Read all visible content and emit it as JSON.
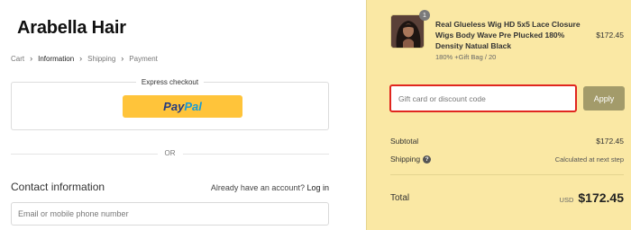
{
  "brand": {
    "name": "Arabella Hair"
  },
  "breadcrumb": {
    "items": [
      "Cart",
      "Information",
      "Shipping",
      "Payment"
    ],
    "active": "Information"
  },
  "express_checkout": {
    "title": "Express checkout",
    "paypal_part1": "Pay",
    "paypal_part2": "Pal"
  },
  "divider_text": "OR",
  "contact": {
    "title": "Contact information",
    "account_prompt": "Already have an account?",
    "login_link": "Log in",
    "email_placeholder": "Email or mobile phone number"
  },
  "order_summary": {
    "item": {
      "quantity_badge": "1",
      "name": "Real Glueless Wig HD 5x5 Lace Closure Wigs Body Wave Pre Plucked 180% Density Natual Black",
      "variant": "180% +Gift Bag / 20",
      "price": "$172.45",
      "image_icon": "wig-product-thumbnail"
    },
    "discount": {
      "placeholder": "Gift card or discount code",
      "apply_label": "Apply"
    },
    "subtotal_label": "Subtotal",
    "subtotal_value": "$172.45",
    "shipping_label": "Shipping",
    "shipping_value": "Calculated at next step",
    "total_label": "Total",
    "total_currency": "USD",
    "total_value": "$172.45"
  },
  "colors": {
    "summary_bg": "#fae8a4",
    "paypal_button": "#ffc43a",
    "discount_highlight": "#e0261f",
    "apply_button": "#a39b6a"
  }
}
